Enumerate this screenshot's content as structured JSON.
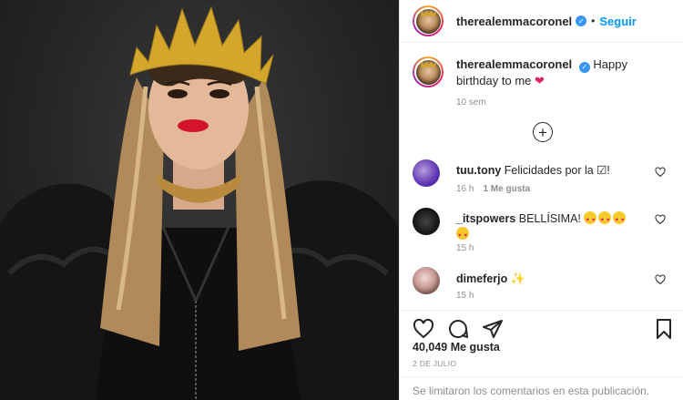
{
  "post": {
    "username": "therealemmacoronel",
    "follow_label": "Seguir",
    "dot": "•",
    "caption": "Happy birthday to me",
    "caption_time": "10 sem",
    "likes": "40,049 Me gusta",
    "date": "2 DE JULIO",
    "comments_disabled": "Se limitaron los comentarios en esta publicación."
  },
  "comments": [
    {
      "username": "tuu.tony",
      "text": "Felicidades por la ☑!",
      "time": "16 h",
      "likes": "1 Me gusta"
    },
    {
      "username": "_itspowers",
      "text": "BELLÍSIMA!",
      "time": "15 h"
    },
    {
      "username": "dimeferjo",
      "text": "",
      "time": "15 h"
    }
  ],
  "colors": {
    "accent": "#0095f6",
    "verified": "#3897f0",
    "heart": "#e0245e",
    "muted": "#8e8e8e"
  },
  "icons": [
    "verified-badge",
    "load-more-plus-icon",
    "heart-icon",
    "comment-icon",
    "share-icon",
    "bookmark-icon",
    "sparkle-emoji"
  ]
}
